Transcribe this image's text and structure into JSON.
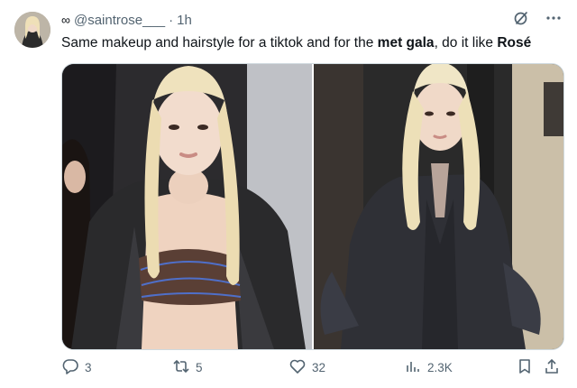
{
  "author": {
    "handle_prefix": "∞",
    "handle": "@saintrose___",
    "separator": "·",
    "time": "1h"
  },
  "tweet": {
    "text_1": "Same makeup and hairstyle for a tiktok and for the ",
    "text_bold_1": "met gala",
    "text_2": ", do it like ",
    "text_bold_2": "Rosé"
  },
  "actions": {
    "replies": "3",
    "reposts": "5",
    "likes": "32",
    "views": "2.3K"
  },
  "icons": {
    "grok": "grok-slash-icon",
    "more": "more-dots-icon",
    "reply": "reply-icon",
    "repost": "repost-icon",
    "like": "heart-icon",
    "views": "analytics-icon",
    "bookmark": "bookmark-icon",
    "share": "share-icon"
  },
  "colors": {
    "text_primary": "#0f1419",
    "text_secondary": "#536471",
    "border": "#cfd9de"
  }
}
